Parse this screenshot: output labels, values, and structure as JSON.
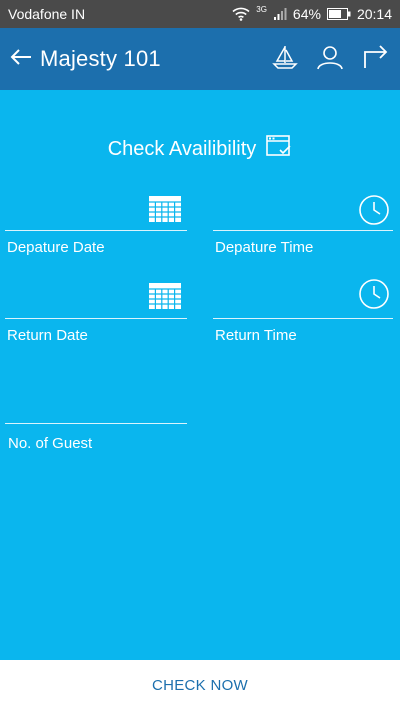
{
  "status_bar": {
    "carrier": "Vodafone IN",
    "network": "3G",
    "battery": "64%",
    "time": "20:14"
  },
  "app_bar": {
    "back_icon": "arrow-left-icon",
    "title": "Majesty 101",
    "actions": [
      "sailboat-icon",
      "user-icon",
      "redirect-icon"
    ]
  },
  "form": {
    "heading": "Check Availibility",
    "heading_icon": "calendar-check-icon",
    "departure_date": {
      "label": "Depature Date",
      "value": "",
      "icon": "calendar-icon"
    },
    "departure_time": {
      "label": "Depature Time",
      "value": "",
      "icon": "clock-icon"
    },
    "return_date": {
      "label": "Return Date",
      "value": "",
      "icon": "calendar-icon"
    },
    "return_time": {
      "label": "Return Time",
      "value": "",
      "icon": "clock-icon"
    },
    "guests": {
      "label": "No. of Guest",
      "value": ""
    }
  },
  "footer": {
    "check_now": "CHECK NOW"
  },
  "colors": {
    "status_bar": "#4a4a4a",
    "app_bar": "#1c6fad",
    "content_bg": "#0ab6ee",
    "footer_text": "#1c6fad"
  }
}
